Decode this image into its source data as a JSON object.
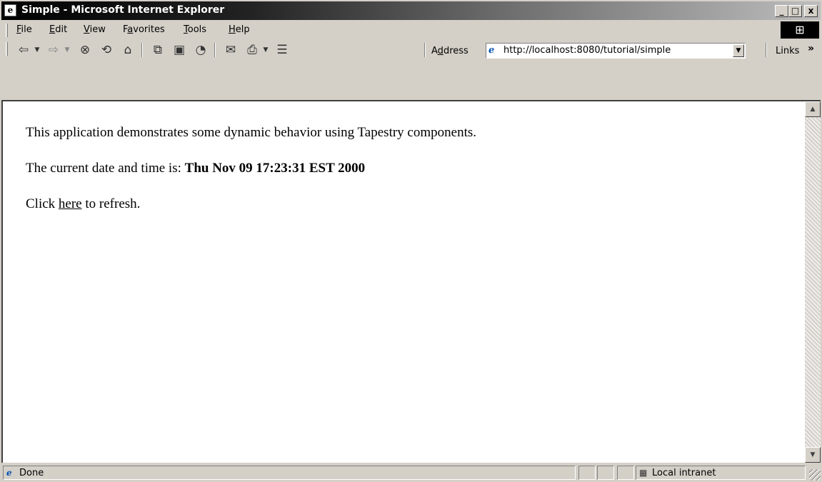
{
  "window": {
    "title": "Simple - Microsoft Internet Explorer",
    "minimize": "_",
    "maximize": "□",
    "close": "x"
  },
  "menu": {
    "items": [
      {
        "pre": "",
        "accel": "F",
        "post": "ile"
      },
      {
        "pre": "",
        "accel": "E",
        "post": "dit"
      },
      {
        "pre": "",
        "accel": "V",
        "post": "iew"
      },
      {
        "pre": "F",
        "accel": "a",
        "post": "vorites"
      },
      {
        "pre": "",
        "accel": "T",
        "post": "ools"
      },
      {
        "pre": "",
        "accel": "H",
        "post": "elp"
      }
    ]
  },
  "toolbar": {
    "address_pre": "A",
    "address_accel": "d",
    "address_post": "dress",
    "url": "http://localhost:8080/tutorial/simple",
    "links_label": "Links",
    "links_chevron": "»"
  },
  "page": {
    "intro": "This application demonstrates some dynamic behavior using Tapestry components.",
    "date_prefix": "The current date and time is: ",
    "date_value": "Thu Nov 09 17:23:31 EST 2000",
    "click_prefix": "Click ",
    "refresh_link": "here",
    "click_suffix": " to refresh."
  },
  "status": {
    "text": "Done",
    "zone": "Local intranet"
  },
  "colors": {
    "window_face": "#d4d0c8",
    "title_start": "#000000",
    "title_end": "#bdbdbd",
    "content_bg": "#ffffff"
  }
}
